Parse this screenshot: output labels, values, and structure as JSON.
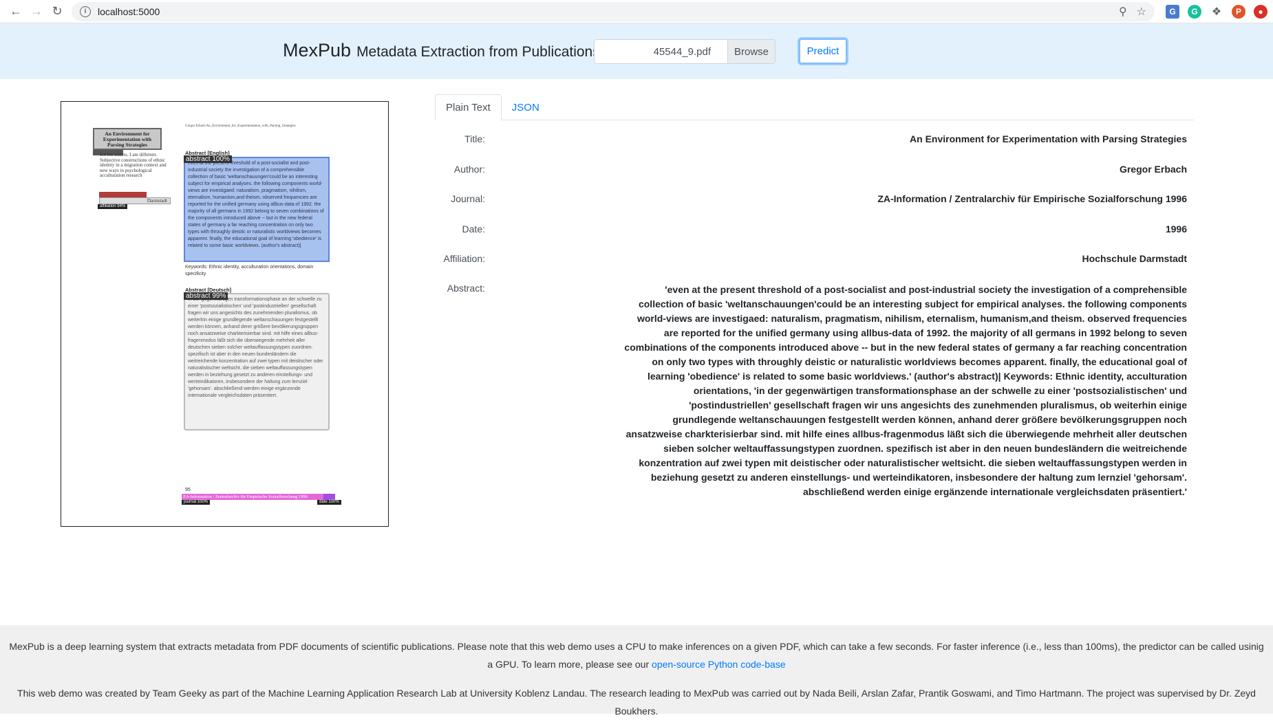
{
  "browser": {
    "url": "localhost:5000",
    "profile_initial": "P"
  },
  "header": {
    "brand": "MexPub",
    "subtitle": "Metadata Extraction from Publications",
    "file_name": "45544_9.pdf",
    "browse_label": "Browse",
    "predict_label": "Predict"
  },
  "pdf_preview": {
    "header_line": "Gregor Erbach An_Environment_for_Experimentation_with_Parsing_Strategies",
    "title_block": "An Environment for Experimentation with Parsing Strategies",
    "left_text": "Ich bin anders. I am different. Subjective constructions of ethnic identity in a migration context and new ways in psychological acculturation research",
    "abstract_en_heading": "Abstract [English]",
    "abstract_en_label": "abstract 100%",
    "abstract_en_text": "even at the present threshold of a post-socialist and post-industrial society the investigation of a comprehensible collection of basic 'weltanschauungen'could be an interesting subject for empirical analyses. the following components world-views are investigaed: naturalism, pragmatism, nihilism, eternalism, humanism,and theism. observed frequencies are reported for the unified germany using allbus-data of 1992. the majority of all germans in 1992 belong to seven combinations of the components introduced above -- but in the new federal states of germany a far reaching concentration on only two types with throughly deistic or naturalistic worldviews becomes apparent. finally, the educational goal of learning 'obedience' is related to some basic worldviews. (author's abstract)|",
    "keywords_text": "Keywords: Ethnic identity, acculturation orientations, domain specificity",
    "abstract_de_heading": "Abstract [Deutsch]",
    "abstract_de_label": "abstract 99%",
    "abstract_de_text": "in der gegenwärtigen transformationsphase an der schwelle zu einer 'postsozialistischen' und 'postindustriellen' gesellschaft fragen wir uns angesichts des zunehmenden pluralismus, ob weiterhin einige grundlegende weltanschauungen festgestellt werden können, anhand derer größere bevölkerungsgruppen noch ansatzweise charkterisierbar sind. mit hilfe eines allbus-fragenmodus läßt sich die überwiegende mehrheit aller deutschen sieben solcher weltauffassungstypen zuordnen. spezifisch ist aber in den neuen bundesländern die weitreichende konzentration auf zwei typen mit deistischer oder naturalistischer weltsicht. die sieben weltauffassungstypen werden in beziehung gesetzt zu anderen einstellungs- und werteindikatoren, insbesondere der haltung zum lernziel 'gehorsam'. abschließend werden einige ergänzende internationale vergleichsdaten präsentiert.",
    "affiliation_label": "affiliation 94%",
    "affiliation_text": "Darmstadt",
    "page_number": "95",
    "journal_text": "ZA-Information / Zentralarchiv für Empirische Sozialforschung 1996",
    "journal_label": "journal 100%",
    "date_label": "date 100%"
  },
  "tabs": [
    {
      "label": "Plain Text",
      "active": true
    },
    {
      "label": "JSON",
      "active": false
    }
  ],
  "fields": {
    "title": {
      "label": "Title:",
      "value": "An Environment for Experimentation with Parsing Strategies"
    },
    "author": {
      "label": "Author:",
      "value": "Gregor Erbach"
    },
    "journal": {
      "label": "Journal:",
      "value": "ZA-Information / Zentralarchiv für Empirische Sozialforschung 1996"
    },
    "date": {
      "label": "Date:",
      "value": "1996"
    },
    "affiliation": {
      "label": "Affiliation:",
      "value": "Hochschule Darmstadt"
    },
    "abstract": {
      "label": "Abstract:",
      "value": "'even at the present threshold of a post-socialist and post-industrial society the investigation of a comprehensible collection of basic 'weltanschauungen'could be an interesting subject for empirical analyses. the following components world-views are investigaed: naturalism, pragmatism, nihilism, eternalism, humanism,and theism. observed frequencies are reported for the unified germany using allbus-data of 1992. the majority of all germans in 1992 belong to seven combinations of the components introduced above -- but in the new federal states of germany a far reaching concentration on only two types with throughly deistic or naturalistic worldviews becomes apparent. finally, the educational goal of learning 'obedience' is related to some basic worldviews.' (author's abstract)| Keywords: Ethnic identity, acculturation orientations, 'in der gegenwärtigen transformationsphase an der schwelle zu einer 'postsozialistischen' und 'postindustriellen' gesellschaft fragen wir uns angesichts des zunehmenden pluralismus, ob weiterhin einige grundlegende weltanschauungen festgestellt werden können, anhand derer größere bevölkerungsgruppen noch ansatzweise charkterisierbar sind. mit hilfe eines allbus-fragenmodus läßt sich die überwiegende mehrheit aller deutschen sieben solcher weltauffassungstypen zuordnen. spezifisch ist aber in den neuen bundesländern die weitreichende konzentration auf zwei typen mit deistischer oder naturalistischer weltsicht. die sieben weltauffassungstypen werden in beziehung gesetzt zu anderen einstellungs- und werteindikatoren, insbesondere der haltung zum lernziel 'gehorsam'. abschließend werden einige ergänzende internationale vergleichsdaten präsentiert.'"
    }
  },
  "footer": {
    "line1_text": "MexPub is a deep learning system that extracts metadata from PDF documents of scientific publications. Please note that this web demo uses a CPU to make inferences on a given PDF, which can take a few seconds. For faster inference (i.e., less than 100ms), the predictor can be called usinig a GPU. To learn more, please see our",
    "line1_link": "open-source Python code-base",
    "line2_text": "This web demo was created by Team Geeky as part of the Machine Learning Application Research Lab at University Koblenz Landau. The research leading to MexPub was carried out by Nada Beili, Arslan Zafar, Prantik Goswami, and Timo Hartmann. The project was supervised by Dr. Zeyd Boukhers."
  }
}
